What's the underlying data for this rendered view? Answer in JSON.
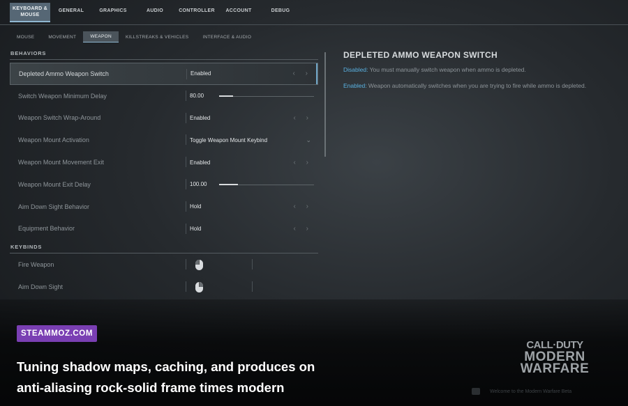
{
  "top_tabs": [
    "KEYBOARD & MOUSE",
    "GENERAL",
    "GRAPHICS",
    "AUDIO",
    "CONTROLLER",
    "ACCOUNT",
    "DEBUG"
  ],
  "sub_tabs": [
    "MOUSE",
    "MOVEMENT",
    "WEAPON",
    "KILLSTREAKS & VEHICLES",
    "INTERFACE & AUDIO"
  ],
  "behaviors": {
    "title": "BEHAVIORS",
    "rows": [
      {
        "label": "Depleted Ammo Weapon Switch",
        "value": "Enabled"
      },
      {
        "label": "Switch Weapon Minimum Delay",
        "value": "80.00",
        "slider": 0.15
      },
      {
        "label": "Weapon Switch Wrap-Around",
        "value": "Enabled"
      },
      {
        "label": "Weapon Mount Activation",
        "value": "Toggle Weapon Mount Keybind"
      },
      {
        "label": "Weapon Mount Movement Exit",
        "value": "Enabled"
      },
      {
        "label": "Weapon Mount Exit Delay",
        "value": "100.00",
        "slider": 0.2
      },
      {
        "label": "Aim Down Sight Behavior",
        "value": "Hold"
      },
      {
        "label": "Equipment Behavior",
        "value": "Hold"
      }
    ]
  },
  "keybinds": {
    "title": "KEYBINDS",
    "rows": [
      {
        "label": "Fire Weapon",
        "icon": "mouse-left-icon"
      },
      {
        "label": "Aim Down Sight",
        "icon": "mouse-right-icon"
      }
    ]
  },
  "info": {
    "title": "DEPLETED AMMO WEAPON SWITCH",
    "disabled_kw": "Disabled:",
    "disabled_text": " You must manually switch weapon when ammo is depleted.",
    "enabled_kw": "Enabled:",
    "enabled_text": " Weapon automatically switches when you are trying to fire while ammo is depleted."
  },
  "overlay": {
    "badge": "STEAMMOZ.COM",
    "headline_line1": "Tuning shadow maps, caching, and produces on",
    "headline_line2": "anti-aliasing rock-solid frame times modern"
  },
  "logo": {
    "line1": "CALL·DUTY",
    "line2": "MODERN",
    "line3": "WARFARE"
  },
  "footer": "Welcome to the Modern Warfare Beta",
  "colors": {
    "accent": "#5ab2e2",
    "badge": "#7a3fb3"
  }
}
